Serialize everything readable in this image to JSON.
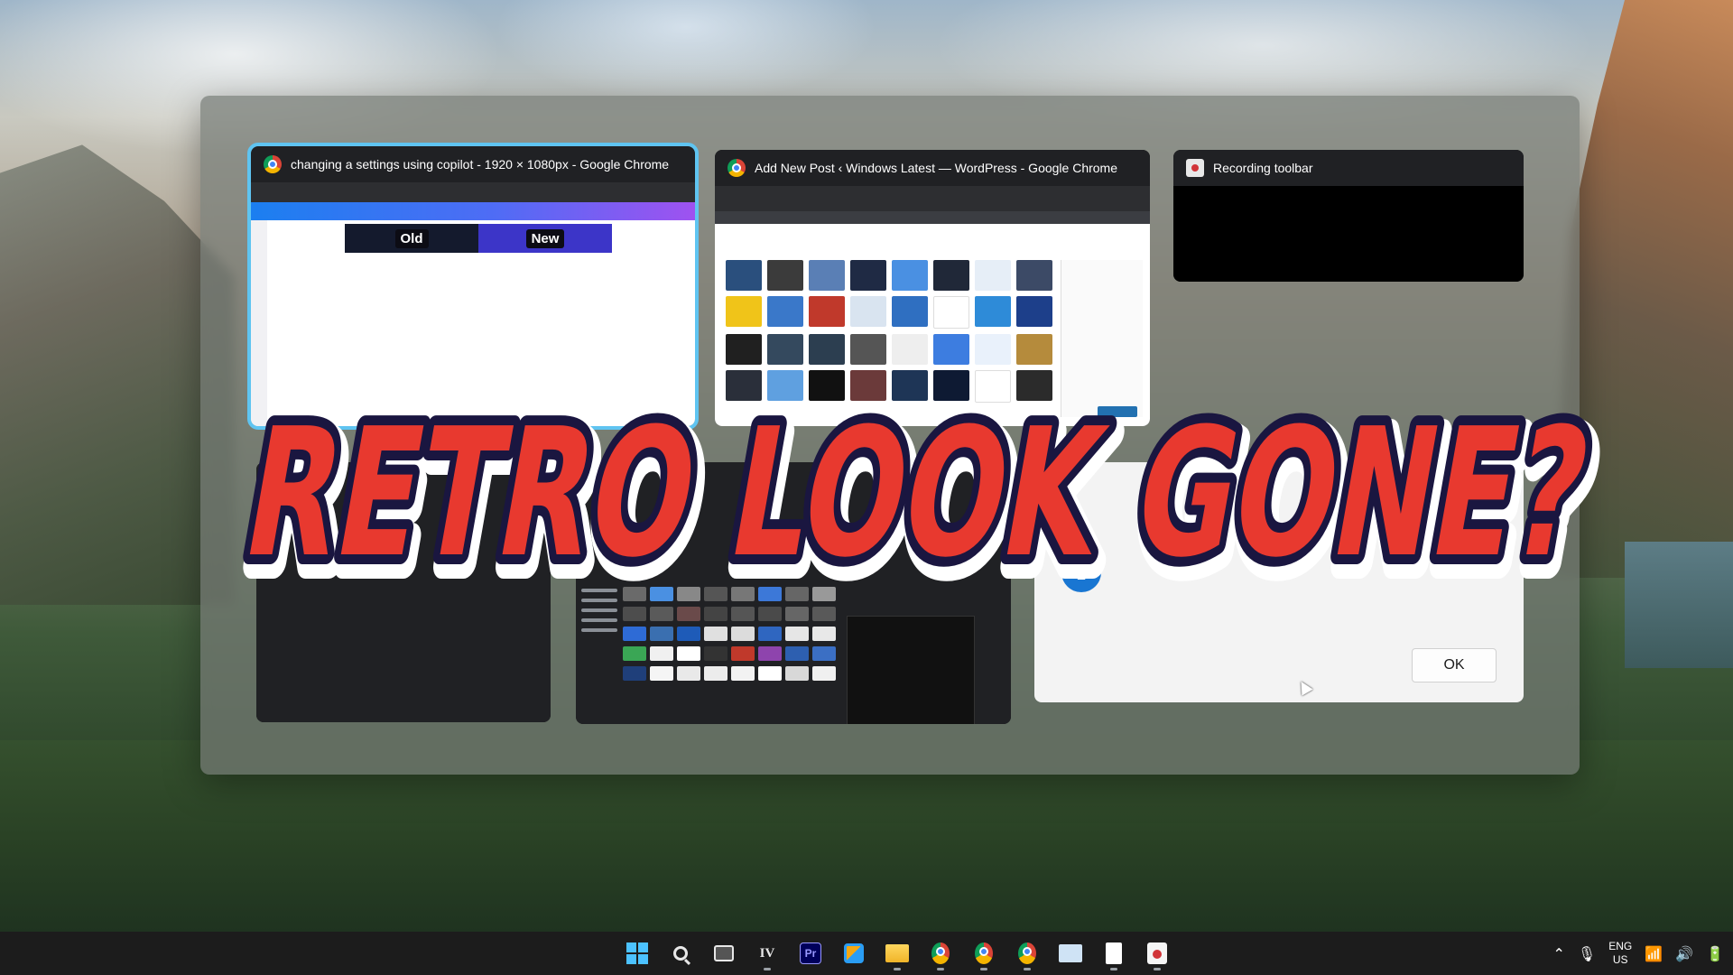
{
  "windows": {
    "copilot": {
      "title": "changing a settings using copilot - 1920 × 1080px - Google Chrome",
      "old_label": "Old",
      "new_label": "New"
    },
    "wordpress": {
      "title": "Add New Post ‹ Windows Latest — WordPress - Google Chrome"
    },
    "recording": {
      "title": "Recording toolbar"
    },
    "dialog": {
      "ok_label": "OK",
      "info_glyph": "i"
    }
  },
  "overlay": {
    "headline": "RETRO LOOK GONE?"
  },
  "taskbar": {
    "icons": [
      "windows-start-icon",
      "search-icon",
      "task-view-icon",
      "irfanview-icon",
      "premiere-pro-icon",
      "microsoft-store-icon",
      "file-explorer-icon",
      "chrome-icon",
      "chrome-profile-2-icon",
      "chrome-profile-3-icon",
      "snipping-tool-icon",
      "notepad-icon",
      "paint-icon"
    ],
    "premiere_label": "Pr",
    "irfanview_label": "IV",
    "tray": {
      "lang_top": "ENG",
      "lang_bottom": "US"
    }
  },
  "colors": {
    "selection": "#5fc4f1",
    "headline_fill": "#e8392f",
    "headline_stroke": "#1a1640",
    "accent": "#4cc2ff"
  }
}
